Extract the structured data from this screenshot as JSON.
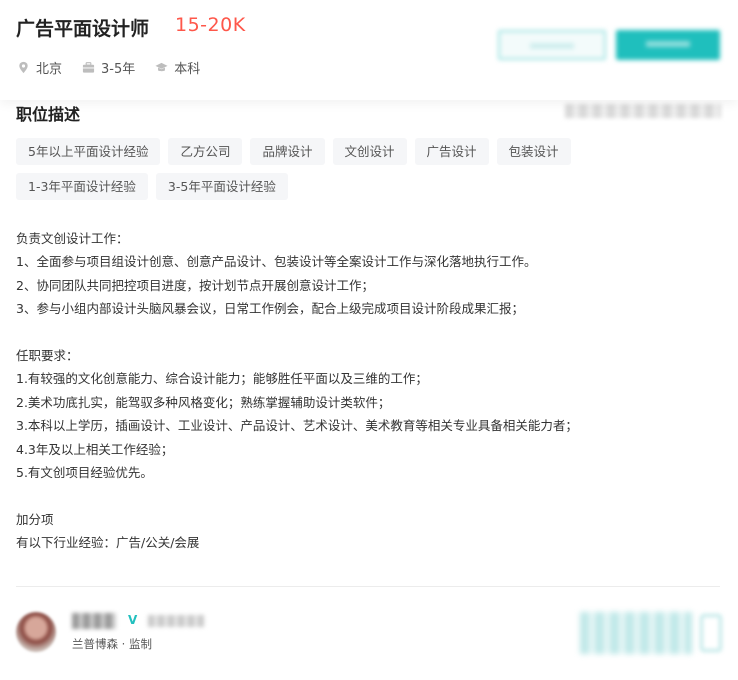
{
  "job": {
    "title": "广告平面设计师",
    "salary": "15-20K",
    "location": "北京",
    "experience": "3-5年",
    "education": "本科"
  },
  "icons": {
    "location": "map-pin-icon",
    "experience": "briefcase-icon",
    "education": "graduation-cap-icon"
  },
  "section": {
    "title": "职位描述"
  },
  "tags": [
    "5年以上平面设计经验",
    "乙方公司",
    "品牌设计",
    "文创设计",
    "广告设计",
    "包装设计",
    "1-3年平面设计经验",
    "3-5年平面设计经验"
  ],
  "description": {
    "duties_heading": "负责文创设计工作：",
    "duties": [
      "1、全面参与项目组设计创意、创意产品设计、包装设计等全案设计工作与深化落地执行工作。",
      "2、协同团队共同把控项目进度，按计划节点开展创意设计工作；",
      "3、参与小组内部设计头脑风暴会议，日常工作例会，配合上级完成项目设计阶段成果汇报；"
    ],
    "requirements_heading": "任职要求：",
    "requirements": [
      "1.有较强的文化创意能力、综合设计能力；能够胜任平面以及三维的工作；",
      "2.美术功底扎实，能驾驭多种风格变化；熟练掌握辅助设计类软件；",
      "3.本科以上学历，插画设计、工业设计、产品设计、艺术设计、美术教育等相关专业具备相关能力者；",
      "4.3年及以上相关工作经验；",
      "5.有文创项目经验优先。"
    ],
    "bonus_heading": "加分项",
    "bonus": "有以下行业经验：广告/公关/会展"
  },
  "recruiter": {
    "verified_mark": "V",
    "company_role": "兰普博森 · 监制"
  },
  "colors": {
    "accent": "#1fbfbd",
    "salary": "#fe574a",
    "tag_bg": "#f5f6f8"
  }
}
